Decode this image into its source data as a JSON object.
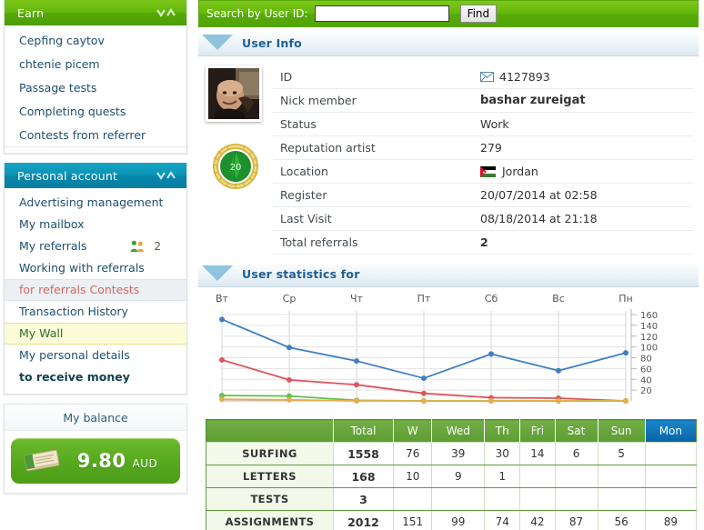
{
  "sidebar": {
    "earn_panel": {
      "title": "Earn",
      "collapse_icon": "chevron-down-up-icon",
      "items": [
        {
          "label": "Cepfing caytov"
        },
        {
          "label": "chtenie picem"
        },
        {
          "label": "Passage tests"
        },
        {
          "label": "Completing quests"
        },
        {
          "label": "Contests from referrer"
        }
      ]
    },
    "account_panel": {
      "title": "Personal account",
      "collapse_icon": "chevron-down-up-icon",
      "items": [
        {
          "label": "Advertising management"
        },
        {
          "label": "My mailbox"
        },
        {
          "label": "My referrals",
          "icon": "two-people-icon",
          "count": "2"
        },
        {
          "label": "Working with referrals"
        },
        {
          "label": "for referrals Contests",
          "state": "selected-gray"
        },
        {
          "label": "Transaction History"
        },
        {
          "label": "My Wall",
          "state": "selected-yellow"
        },
        {
          "label": "My personal details"
        },
        {
          "label": "to receive money",
          "state": "bold"
        }
      ]
    },
    "balance": {
      "title": "My balance",
      "icon": "money-bundle-icon",
      "amount": "9.80",
      "currency": "AUD"
    }
  },
  "search": {
    "label": "Search by User ID:",
    "value": "",
    "placeholder": "",
    "button_label": "Find"
  },
  "user_info": {
    "section_title": "User Info",
    "avatar": "user-avatar",
    "badge_level": "20",
    "rows": [
      {
        "key": "ID",
        "value": "4127893",
        "icon": "envelope-icon"
      },
      {
        "key": "Nick member",
        "value": "bashar zureigat"
      },
      {
        "key": "Status",
        "value": "Work"
      },
      {
        "key": "Reputation artist",
        "value": "279"
      },
      {
        "key": "Location",
        "value": "Jordan",
        "icon": "jordan-flag-icon"
      },
      {
        "key": "Register",
        "value": "20/07/2014 at 02:58"
      },
      {
        "key": "Last Visit",
        "value": "08/18/2014 at 21:18"
      },
      {
        "key": "Total referrals",
        "value": "2"
      }
    ]
  },
  "statistics": {
    "section_title": "User statistics for"
  },
  "chart_data": {
    "type": "line",
    "title": "User statistics for",
    "xlabel": "",
    "ylabel": "",
    "categories": [
      "Вт",
      "Ср",
      "Чт",
      "Пт",
      "Сб",
      "Вс",
      "Пн"
    ],
    "ylim": [
      0,
      160
    ],
    "yticks": [
      20,
      40,
      60,
      80,
      100,
      120,
      140,
      160
    ],
    "grid": true,
    "legend": "none",
    "series": [
      {
        "name": "ASSIGNMENTS",
        "color": "#3f7fc1",
        "values": [
          151,
          99,
          74,
          42,
          87,
          56,
          89
        ]
      },
      {
        "name": "SURFING",
        "color": "#e0535d",
        "values": [
          76,
          39,
          30,
          14,
          6,
          5,
          0
        ]
      },
      {
        "name": "LETTERS",
        "color": "#5fc14a",
        "values": [
          10,
          9,
          1,
          0,
          0,
          0,
          0
        ]
      },
      {
        "name": "TESTS",
        "color": "#e8ac4e",
        "values": [
          3,
          2,
          0,
          0,
          0,
          0,
          0
        ]
      }
    ]
  },
  "stats_table": {
    "columns": [
      "",
      "Total",
      "W",
      "Wed",
      "Th",
      "Fri",
      "Sat",
      "Sun",
      "Mon"
    ],
    "highlighted_column": "Mon",
    "rows": [
      {
        "label": "SURFING",
        "cells": [
          "1558",
          "76",
          "39",
          "30",
          "14",
          "6",
          "5",
          ""
        ]
      },
      {
        "label": "LETTERS",
        "cells": [
          "168",
          "10",
          "9",
          "1",
          "",
          "",
          "",
          ""
        ]
      },
      {
        "label": "TESTS",
        "cells": [
          "3",
          "",
          "",
          "",
          "",
          "",
          "",
          ""
        ]
      },
      {
        "label": "ASSIGNMENTS",
        "cells": [
          "2012",
          "151",
          "99",
          "74",
          "42",
          "87",
          "56",
          "89"
        ]
      }
    ]
  }
}
